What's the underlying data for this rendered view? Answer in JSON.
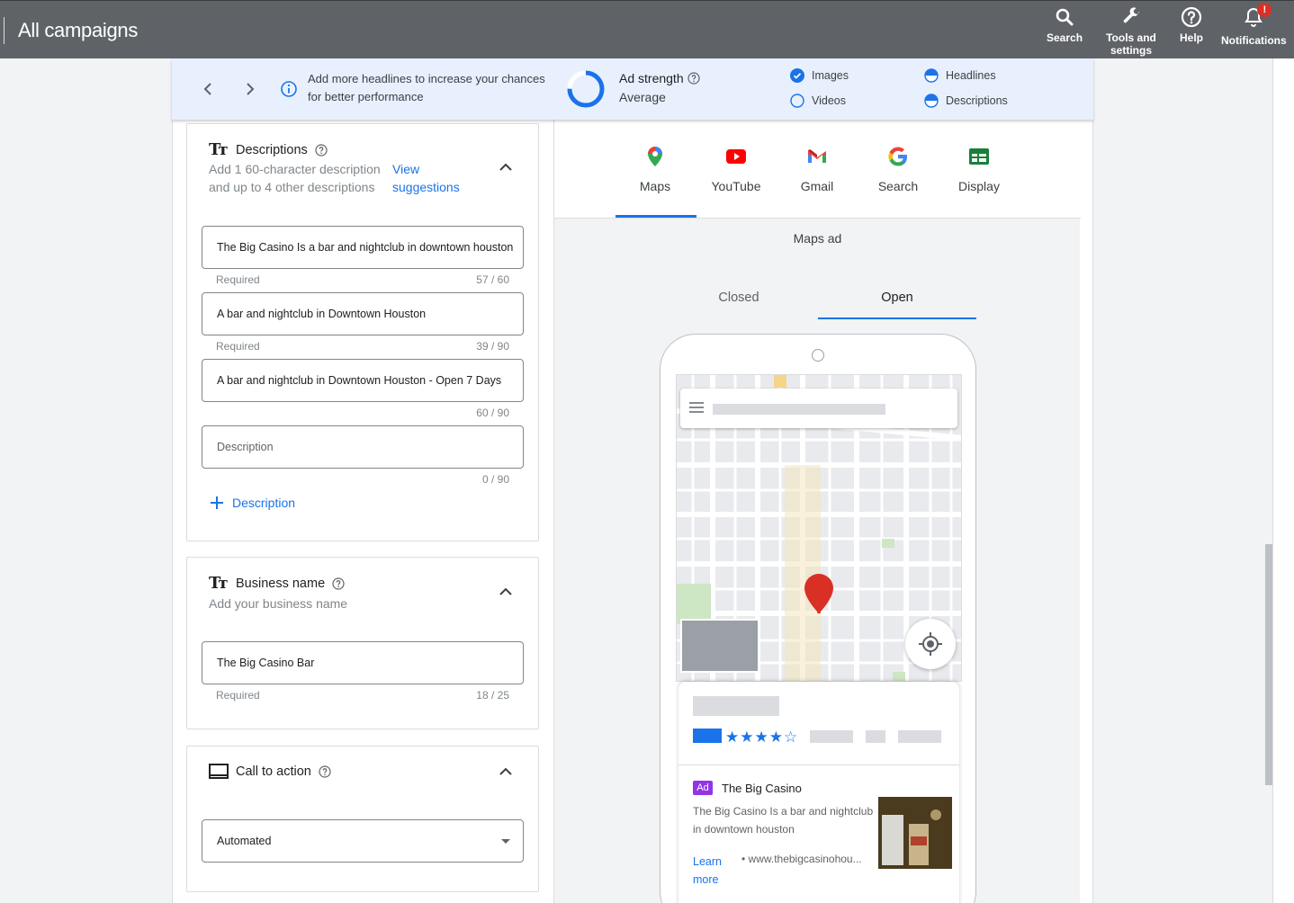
{
  "header": {
    "title": "All campaigns",
    "buttons": [
      {
        "label": "Search",
        "icon": "search-icon"
      },
      {
        "label": "Tools and settings",
        "icon": "wrench-icon"
      },
      {
        "label": "Help",
        "icon": "help-icon"
      },
      {
        "label": "Notifications",
        "icon": "bell-icon",
        "badge": "!"
      }
    ]
  },
  "banner": {
    "tip": "Add more headlines to increase your chances for better performance",
    "strength_label": "Ad strength",
    "strength_value": "Average",
    "checklist": [
      {
        "label": "Images",
        "state": "done"
      },
      {
        "label": "Videos",
        "state": "empty"
      },
      {
        "label": "Headlines",
        "state": "partial"
      },
      {
        "label": "Descriptions",
        "state": "partial"
      }
    ]
  },
  "descriptions": {
    "title": "Descriptions",
    "sub_line1": "Add 1 60-character description",
    "sub_line2": "and up to 4 other descriptions",
    "link_line1": "View",
    "link_line2": "suggestions",
    "fields": [
      {
        "value": "The Big Casino Is a bar and nightclub in downtown houston",
        "hint": "Required",
        "count": "57 / 60"
      },
      {
        "value": "A bar and nightclub in Downtown Houston",
        "hint": "Required",
        "count": "39 / 90"
      },
      {
        "value": "A bar and nightclub in Downtown Houston - Open 7 Days",
        "hint": "",
        "count": "60 / 90"
      },
      {
        "value": "",
        "placeholder": "Description",
        "hint": "",
        "count": "0 / 90"
      }
    ],
    "add_label": "Description"
  },
  "business": {
    "title": "Business name",
    "sub": "Add your business name",
    "value": "The Big Casino Bar",
    "hint": "Required",
    "count": "18 / 25"
  },
  "cta": {
    "title": "Call to action",
    "value": "Automated"
  },
  "preview": {
    "tabs": [
      "Maps",
      "YouTube",
      "Gmail",
      "Search",
      "Display"
    ],
    "active_tab": "Maps",
    "ad_type": "Maps ad",
    "states": [
      "Closed",
      "Open"
    ],
    "active_state": "Open",
    "ad": {
      "badge": "Ad",
      "name": "The Big Casino",
      "description": "The Big Casino Is a bar and nightclub in downtown houston",
      "learn_more": "Learn more",
      "url": "• www.thebigcasinohou..."
    },
    "rating": 4
  }
}
